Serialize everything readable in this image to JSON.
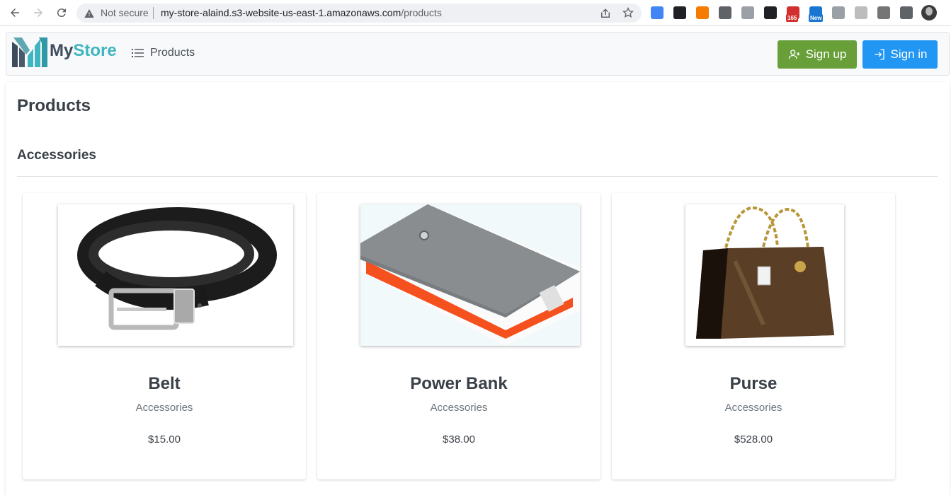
{
  "browser": {
    "security_label": "Not secure",
    "url_host": "my-store-alaind.s3-website-us-east-1.amazonaws.com",
    "url_path": "/products",
    "extensions": [
      {
        "name": "translate-icon",
        "color": "#4285f4"
      },
      {
        "name": "tab-icon",
        "color": "#202124"
      },
      {
        "name": "orange-circle-icon",
        "color": "#f57c00"
      },
      {
        "name": "barcode-icon",
        "color": "#5f6368"
      },
      {
        "name": "target-icon",
        "color": "#9aa0a6"
      },
      {
        "name": "copy-icon",
        "color": "#202124"
      },
      {
        "name": "calendar-icon",
        "color": "#d32f2f",
        "badge": "165"
      },
      {
        "name": "news-icon",
        "color": "#1976d2",
        "badge": "New"
      },
      {
        "name": "wifi-icon",
        "color": "#9aa0a6"
      },
      {
        "name": "grid-icon",
        "color": "#bdbdbd"
      },
      {
        "name": "pdf-icon",
        "color": "#757575"
      },
      {
        "name": "puzzle-icon",
        "color": "#5f6368"
      }
    ]
  },
  "navbar": {
    "logo_my": "My",
    "logo_store": "Store",
    "products_link": "Products",
    "signup_label": "Sign up",
    "signin_label": "Sign in",
    "signup_color": "#689f38",
    "signin_color": "#2196f3"
  },
  "main": {
    "title": "Products",
    "section_title": "Accessories",
    "products": [
      {
        "name": "Belt",
        "category": "Accessories",
        "price": "$15.00",
        "image": "belt"
      },
      {
        "name": "Power Bank",
        "category": "Accessories",
        "price": "$38.00",
        "image": "power-bank"
      },
      {
        "name": "Purse",
        "category": "Accessories",
        "price": "$528.00",
        "image": "purse"
      }
    ]
  }
}
